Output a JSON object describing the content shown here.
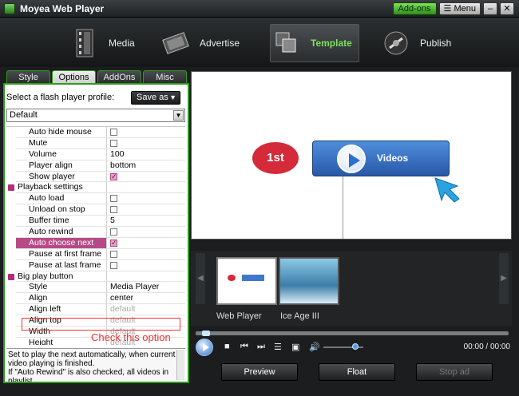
{
  "window": {
    "title": "Moyea Web Player",
    "addons_label": "Add-ons",
    "menu_label": "Menu",
    "minimize_glyph": "–",
    "close_glyph": "✕"
  },
  "nav": [
    {
      "label": "Media",
      "icon": "film-icon"
    },
    {
      "label": "Advertise",
      "icon": "film-reel-icon"
    },
    {
      "label": "Template",
      "icon": "template-icon",
      "active": true
    },
    {
      "label": "Publish",
      "icon": "publish-icon"
    }
  ],
  "tabs": [
    {
      "label": "Style"
    },
    {
      "label": "Options",
      "active": true
    },
    {
      "label": "AddOns"
    },
    {
      "label": "Misc"
    }
  ],
  "profile": {
    "label": "Select a flash player profile:",
    "saveas_label": "Save as",
    "selected": "Default"
  },
  "grid_rows": [
    {
      "name": "Auto hide mouse",
      "type": "check",
      "checked": false
    },
    {
      "name": "Mute",
      "type": "check",
      "checked": false
    },
    {
      "name": "Volume",
      "type": "text",
      "value": "100"
    },
    {
      "name": "Player align",
      "type": "text",
      "value": "bottom"
    },
    {
      "name": "Show player",
      "type": "check",
      "checked": true
    },
    {
      "name": "Playback settings",
      "type": "category"
    },
    {
      "name": "Auto load",
      "type": "check",
      "checked": false
    },
    {
      "name": "Unload on stop",
      "type": "check",
      "checked": false
    },
    {
      "name": "Buffer time",
      "type": "text",
      "value": "5"
    },
    {
      "name": "Auto rewind",
      "type": "check",
      "checked": false
    },
    {
      "name": "Auto choose next",
      "type": "check",
      "checked": true,
      "highlight": true
    },
    {
      "name": "Pause at first frame",
      "type": "check",
      "checked": false
    },
    {
      "name": "Pause at last frame",
      "type": "check",
      "checked": false
    },
    {
      "name": "Big play button",
      "type": "category"
    },
    {
      "name": "Style",
      "type": "text",
      "value": "Media Player"
    },
    {
      "name": "Align",
      "type": "text",
      "value": "center"
    },
    {
      "name": "Align left",
      "type": "text",
      "value": "default",
      "muted": true
    },
    {
      "name": "Align top",
      "type": "text",
      "value": "default",
      "muted": true
    },
    {
      "name": "Width",
      "type": "text",
      "value": "default",
      "muted": true
    },
    {
      "name": "Height",
      "type": "text",
      "value": "default",
      "muted": true
    }
  ],
  "annotation": "Check this option",
  "description": "Set to play the next automatically, when current video playing is finished.\nIf \"Auto Rewind\" is also checked, all videos in playlist",
  "preview": {
    "badge_text": "1st",
    "video_button_label": "Videos"
  },
  "thumbs": [
    {
      "label": "Web Player"
    },
    {
      "label": "Ice Age III"
    }
  ],
  "player": {
    "time": "00:00 / 00:00",
    "seek_progress": 0.02,
    "volume_level": 0.8
  },
  "buttons": {
    "preview": "Preview",
    "float": "Float",
    "stop_ad": "Stop ad"
  },
  "colors": {
    "accent_green": "#2e9a1a",
    "highlight_pink": "#b64a87",
    "annotation_red": "#e33333"
  }
}
